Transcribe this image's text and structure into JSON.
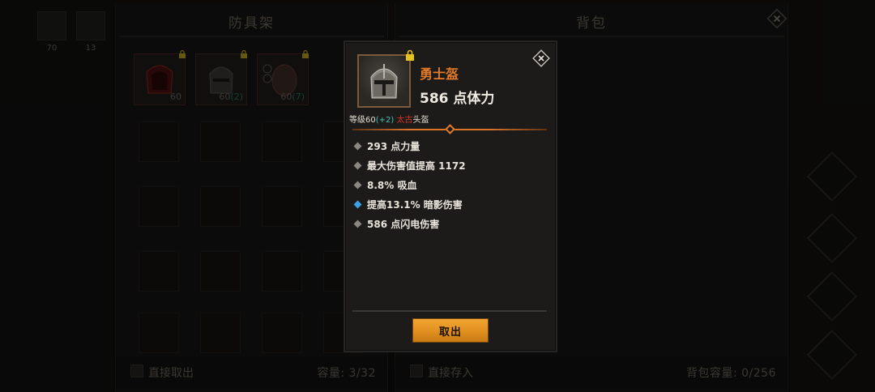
{
  "scene": {
    "top_slots": [
      {
        "count": "70"
      },
      {
        "count": "13"
      }
    ]
  },
  "rack_panel": {
    "title": "防具架",
    "items": [
      {
        "level": "60",
        "bonus": ""
      },
      {
        "level": "60",
        "bonus": "(2)"
      },
      {
        "level": "60",
        "bonus": "(7)"
      }
    ],
    "direct_take_label": "直接取出",
    "capacity": "容量: 3/32"
  },
  "bag_panel": {
    "title": "背包",
    "direct_store_label": "直接存入",
    "capacity": "背包容量: 0/256"
  },
  "tooltip": {
    "item_name": "勇士盔",
    "main_stat": "586 点体力",
    "meta": {
      "level_prefix": "等级60",
      "level_bonus": "(+2)",
      "rarity": "太古",
      "slot": "头盔"
    },
    "stats": [
      {
        "text": "293 点力量",
        "highlight": false
      },
      {
        "text": "最大伤害值提高 1172",
        "highlight": false
      },
      {
        "text": "8.8% 吸血",
        "highlight": false
      },
      {
        "text": "提高13.1% 暗影伤害",
        "highlight": true
      },
      {
        "text": "586 点闪电伤害",
        "highlight": false
      }
    ],
    "action_button": "取出"
  },
  "colors": {
    "item_name": "#e27a2a",
    "rarity": "#d6332a",
    "bonus": "#3fc7b5",
    "button": "#e0901f",
    "highlight_bullet": "#3ba0e8"
  }
}
